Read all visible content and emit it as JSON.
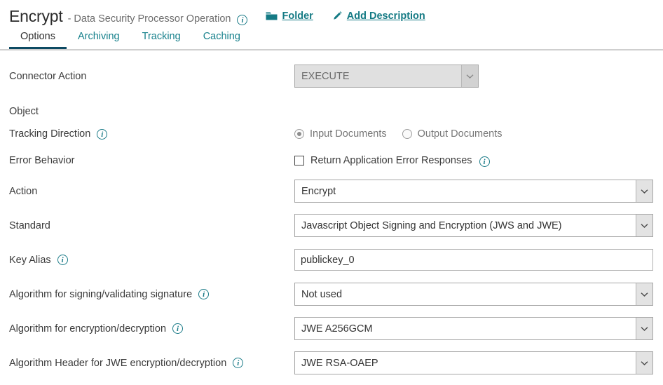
{
  "header": {
    "title": "Encrypt",
    "subtitle": "- Data Security Processor Operation",
    "info_icon": "info-icon",
    "links": [
      {
        "icon": "folder-icon",
        "label": "Folder"
      },
      {
        "icon": "pencil-icon",
        "label": "Add Description"
      }
    ]
  },
  "tabs": [
    {
      "label": "Options",
      "active": true
    },
    {
      "label": "Archiving",
      "active": false
    },
    {
      "label": "Tracking",
      "active": false
    },
    {
      "label": "Caching",
      "active": false
    }
  ],
  "form": {
    "connector_action": {
      "label": "Connector Action",
      "value": "EXECUTE",
      "disabled": true
    },
    "object": {
      "label": "Object"
    },
    "tracking_direction": {
      "label": "Tracking Direction",
      "options": [
        {
          "label": "Input Documents",
          "selected": true
        },
        {
          "label": "Output Documents",
          "selected": false
        }
      ]
    },
    "error_behavior": {
      "label": "Error Behavior",
      "checkbox_label": "Return Application Error Responses",
      "checked": false
    },
    "action": {
      "label": "Action",
      "value": "Encrypt"
    },
    "standard": {
      "label": "Standard",
      "value": "Javascript Object Signing and Encryption (JWS and JWE)"
    },
    "key_alias": {
      "label": "Key Alias",
      "value": "publickey_0",
      "placeholder": ""
    },
    "algorithm_signing": {
      "label": "Algorithm for signing/validating signature",
      "value": "Not used"
    },
    "algorithm_encryption": {
      "label": "Algorithm for encryption/decryption",
      "value": "JWE A256GCM"
    },
    "algorithm_header_jwe": {
      "label": "Algorithm Header for JWE encryption/decryption",
      "value": "JWE RSA-OAEP"
    }
  },
  "colors": {
    "accent_teal": "#147a84",
    "tab_active_underline": "#0d4a63",
    "text_primary": "#333333",
    "disabled_bg": "#e0e0e0"
  }
}
